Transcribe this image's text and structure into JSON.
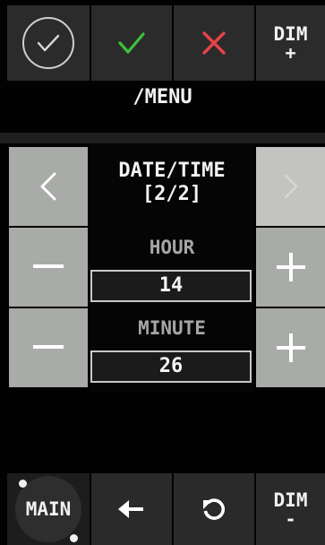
{
  "top_bar": {
    "check_circle_icon": "check-circle-icon",
    "accept_icon": "green-check-icon",
    "accept_color": "#3cc13c",
    "cancel_icon": "red-x-icon",
    "cancel_color": "#e8434a",
    "dim_up_label": "DIM",
    "dim_up_sign": "+"
  },
  "menu": {
    "title": "/MENU"
  },
  "page": {
    "title_line1": "DATE/TIME",
    "title_line2": "[2/2]",
    "prev_icon": "chevron-left-icon",
    "next_icon": "chevron-right-icon",
    "next_disabled": true
  },
  "fields": [
    {
      "label": "HOUR",
      "value": "14",
      "decrement_icon": "minus-icon",
      "increment_icon": "plus-icon"
    },
    {
      "label": "MINUTE",
      "value": "26",
      "decrement_icon": "minus-icon",
      "increment_icon": "plus-icon"
    }
  ],
  "bottom_bar": {
    "main_label": "MAIN",
    "back_icon": "arrow-left-icon",
    "reset_icon": "refresh-icon",
    "dim_down_label": "DIM",
    "dim_down_sign": "-"
  }
}
